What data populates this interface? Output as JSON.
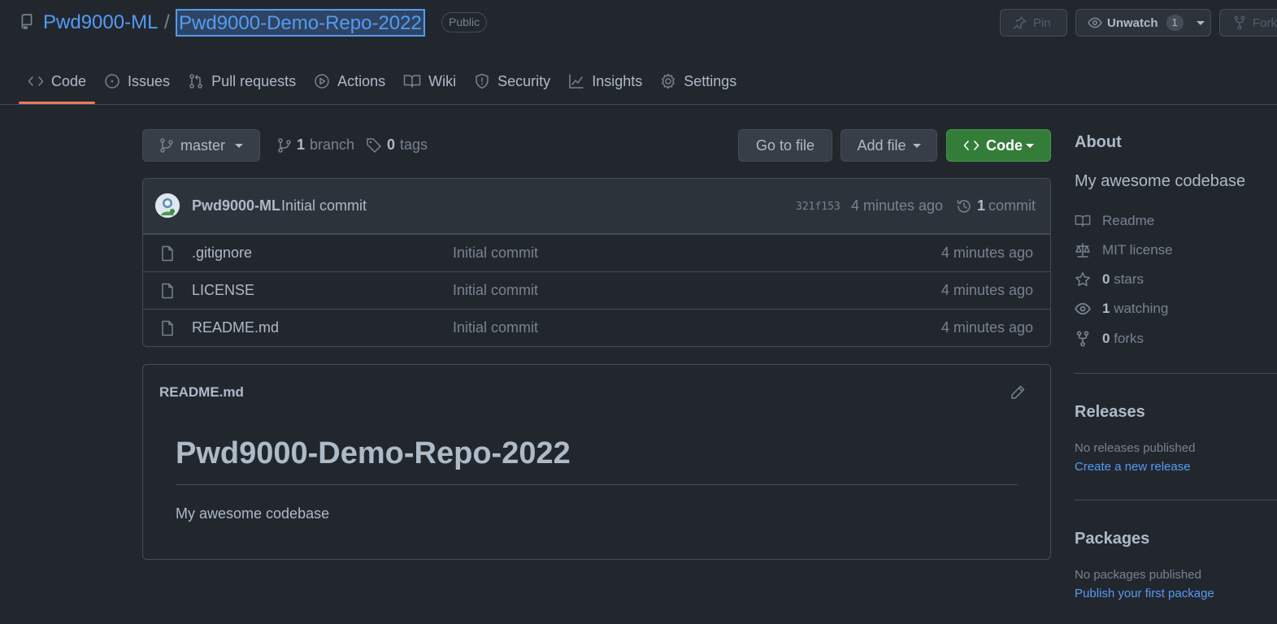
{
  "header": {
    "owner": "Pwd9000-ML",
    "separator": "/",
    "repo": "Pwd9000-Demo-Repo-2022",
    "visibility": "Public",
    "pin_label": "Pin",
    "watch_label": "Unwatch",
    "watch_count": "1",
    "fork_label": "Fork"
  },
  "tabs": [
    {
      "label": "Code",
      "icon": "code-icon",
      "active": true
    },
    {
      "label": "Issues",
      "icon": "issue-icon"
    },
    {
      "label": "Pull requests",
      "icon": "pull-request-icon"
    },
    {
      "label": "Actions",
      "icon": "play-icon"
    },
    {
      "label": "Wiki",
      "icon": "book-icon"
    },
    {
      "label": "Security",
      "icon": "shield-icon"
    },
    {
      "label": "Insights",
      "icon": "graph-icon"
    },
    {
      "label": "Settings",
      "icon": "gear-icon"
    }
  ],
  "toolbar": {
    "branch": "master",
    "branch_count": "1",
    "branch_word": "branch",
    "tag_count": "0",
    "tag_word": "tags",
    "goto_file": "Go to file",
    "add_file": "Add file",
    "code": "Code"
  },
  "latest_commit": {
    "author": "Pwd9000-ML",
    "message": "Initial commit",
    "sha": "321f153",
    "time": "4 minutes ago",
    "count": "1",
    "count_word": "commit"
  },
  "files": [
    {
      "name": ".gitignore",
      "message": "Initial commit",
      "time": "4 minutes ago"
    },
    {
      "name": "LICENSE",
      "message": "Initial commit",
      "time": "4 minutes ago"
    },
    {
      "name": "README.md",
      "message": "Initial commit",
      "time": "4 minutes ago"
    }
  ],
  "readme": {
    "filename": "README.md",
    "heading": "Pwd9000-Demo-Repo-2022",
    "body": "My awesome codebase"
  },
  "sidebar": {
    "about_title": "About",
    "description": "My awesome codebase",
    "readme": "Readme",
    "license": "MIT license",
    "stars_count": "0",
    "stars_word": "stars",
    "watching_count": "1",
    "watching_word": "watching",
    "forks_count": "0",
    "forks_word": "forks",
    "releases_title": "Releases",
    "releases_none": "No releases published",
    "releases_link": "Create a new release",
    "packages_title": "Packages",
    "packages_none": "No packages published",
    "packages_link": "Publish your first package"
  },
  "colors": {
    "background": "#22272e",
    "accent_link": "#539bf5",
    "code_button": "#347d39",
    "active_tab_underline": "#ec775c"
  }
}
